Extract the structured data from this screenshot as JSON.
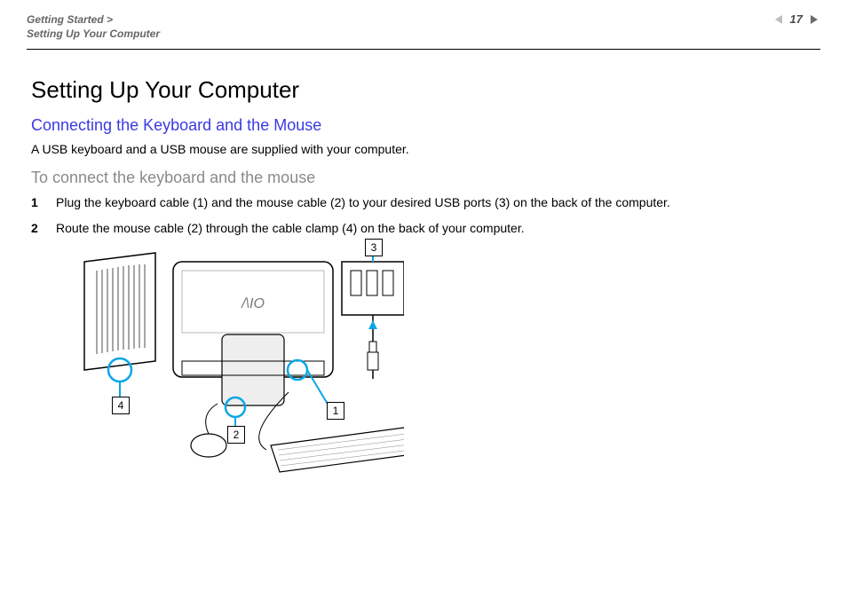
{
  "breadcrumb": {
    "line1": "Getting Started >",
    "line2": "Setting Up Your Computer"
  },
  "page_number": "17",
  "heading": "Setting Up Your Computer",
  "section_title": "Connecting the Keyboard and the Mouse",
  "intro": "A USB keyboard and a USB mouse are supplied with your computer.",
  "procedure_title": "To connect the keyboard and the mouse",
  "steps": [
    {
      "n": "1",
      "text": "Plug the keyboard cable (1) and the mouse cable (2) to your desired USB ports (3) on the back of the computer."
    },
    {
      "n": "2",
      "text": "Route the mouse cable (2) through the cable clamp (4) on the back of your computer."
    }
  ],
  "callouts": {
    "c1": "1",
    "c2": "2",
    "c3": "3",
    "c4": "4"
  }
}
